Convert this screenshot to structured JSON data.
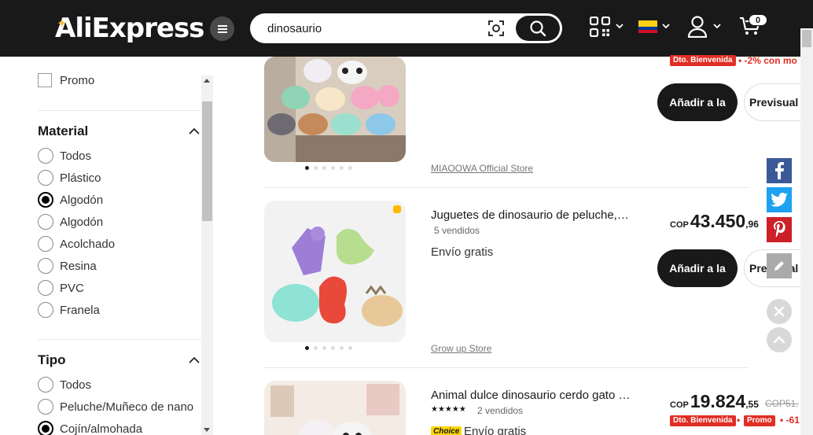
{
  "header": {
    "logo": "AliExpress",
    "search_value": "dinosaurio",
    "cart_count": "0"
  },
  "sidebar": {
    "promo_label": "Promo",
    "material": {
      "title": "Material",
      "options": [
        "Todos",
        "Plástico",
        "Algodón",
        "Algodón",
        "Acolchado",
        "Resina",
        "PVC",
        "Franela"
      ],
      "selected_index": 2
    },
    "tipo": {
      "title": "Tipo",
      "options": [
        "Todos",
        "Peluche/Muñeco de nano",
        "Cojín/almohada"
      ],
      "selected_index": 2
    }
  },
  "products": [
    {
      "store": "MIAOOWA Official Store",
      "tag": "Dto. Bienvenida",
      "tag_note": "• -2% con mo",
      "add_label": "Añadir a la",
      "preview_label": "Previsual"
    },
    {
      "title": "Juguetes de dinosaurio de peluche, al...",
      "sold": "5 vendidos",
      "shipping": "Envío gratis",
      "currency": "COP",
      "price_int": "43.450",
      "price_dec": ",96",
      "store": "Grow up Store",
      "add_label": "Añadir a la",
      "preview_label": "Previsual"
    },
    {
      "title": "Animal dulce dinosaurio cerdo gato o...",
      "sold": "2 vendidos",
      "choice_badge": "Choice",
      "shipping": "Envío gratis",
      "currency": "COP",
      "price_int": "19.824",
      "price_dec": ",55",
      "old_price": "COP51.",
      "tag": "Dto. Bienvenida",
      "tag2": "Promo",
      "tag_note": "• -61"
    }
  ],
  "social": {
    "facebook": "f",
    "twitter": "twitter-bird",
    "pinterest": "p",
    "edit": "pencil"
  },
  "colors": {
    "header_bg": "#191919",
    "accent_red": "#e02e24",
    "facebook": "#3b5998",
    "twitter": "#1da1f2",
    "pinterest": "#cb2027"
  }
}
